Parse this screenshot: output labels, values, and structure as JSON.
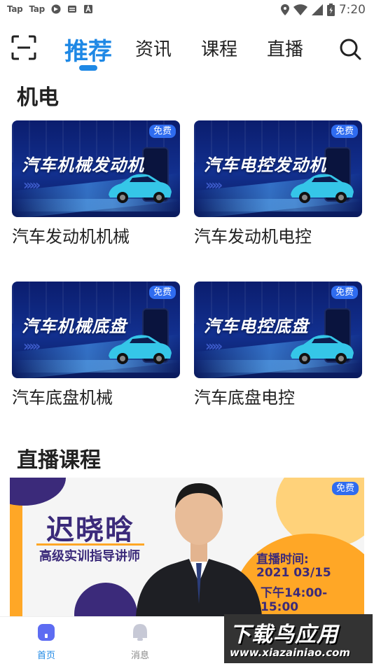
{
  "status_bar": {
    "left_items": [
      "Tap",
      "Tap"
    ],
    "time": "7:20"
  },
  "top_nav": {
    "tabs": [
      {
        "label": "推荐",
        "active": true
      },
      {
        "label": "资讯",
        "active": false
      },
      {
        "label": "课程",
        "active": false
      },
      {
        "label": "直播",
        "active": false
      }
    ],
    "accent_color": "#1e88e5"
  },
  "sections": {
    "mechatronics": {
      "title": "机电",
      "courses": [
        {
          "thumb_title": "汽车机械发动机",
          "badge": "免费",
          "label": "汽车发动机机械"
        },
        {
          "thumb_title": "汽车电控发动机",
          "badge": "免费",
          "label": "汽车发动机电控"
        },
        {
          "thumb_title": "汽车机械底盘",
          "badge": "免费",
          "label": "汽车底盘机械"
        },
        {
          "thumb_title": "汽车电控底盘",
          "badge": "免费",
          "label": "汽车底盘电控"
        }
      ]
    },
    "live": {
      "title": "直播课程",
      "banner": {
        "badge": "免费",
        "lecturer_name": "迟晓晗",
        "lecturer_title": "高级实训指导讲师",
        "time_label": "直播时间:",
        "date": "2021 03/15",
        "hours": "下午14:00-15:00"
      }
    }
  },
  "bottom_nav": {
    "items": [
      {
        "label": "首页",
        "active": true
      },
      {
        "label": "消息",
        "active": false
      }
    ]
  },
  "watermark": {
    "title": "下载鸟应用",
    "url": "www.xiazainiao.com"
  }
}
